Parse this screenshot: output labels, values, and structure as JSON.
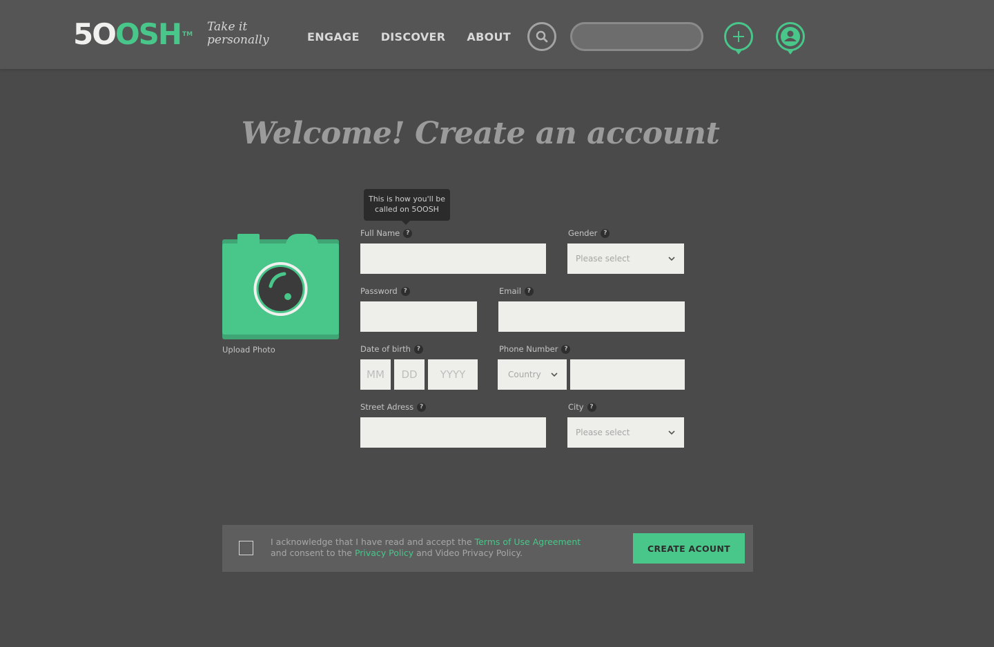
{
  "brand": {
    "logo_part1": "5O",
    "logo_part2": "OSH",
    "logo_tm": "TM",
    "tagline_line1": "Take it",
    "tagline_line2": "personally",
    "accent_color": "#49c68a"
  },
  "nav": {
    "items": [
      "ENGAGE",
      "DISCOVER",
      "ABOUT"
    ]
  },
  "header": {
    "search_placeholder": "",
    "icons": [
      "search-icon",
      "add-pin-icon",
      "profile-pin-icon"
    ]
  },
  "page": {
    "title": "Welcome!  Create an account"
  },
  "photo": {
    "upload_label": "Upload Photo",
    "icon": "camera-icon"
  },
  "tooltip": {
    "line1": "This is how you'll be",
    "line2": "called on 5OOSH"
  },
  "form": {
    "full_name_label": "Full Name",
    "gender_label": "Gender",
    "gender_value": "Please select",
    "password_label": "Password",
    "email_label": "Email",
    "dob_label": "Date of birth",
    "dob_mm": "MM",
    "dob_dd": "DD",
    "dob_yyyy": "YYYY",
    "phone_label": "Phone Number",
    "country_value": "Country",
    "street_label": "Street Adress",
    "city_label": "City",
    "city_value": "Please select",
    "help_glyph": "?"
  },
  "terms": {
    "text1": "I acknowledge that I have read and accept the ",
    "terms_link": "Terms of Use Agreement",
    "text2": "and consent to the ",
    "privacy_link": "Privacy Policy",
    "text3": " and Video Privacy Policy.",
    "button_label": "CREATE ACOUNT"
  }
}
